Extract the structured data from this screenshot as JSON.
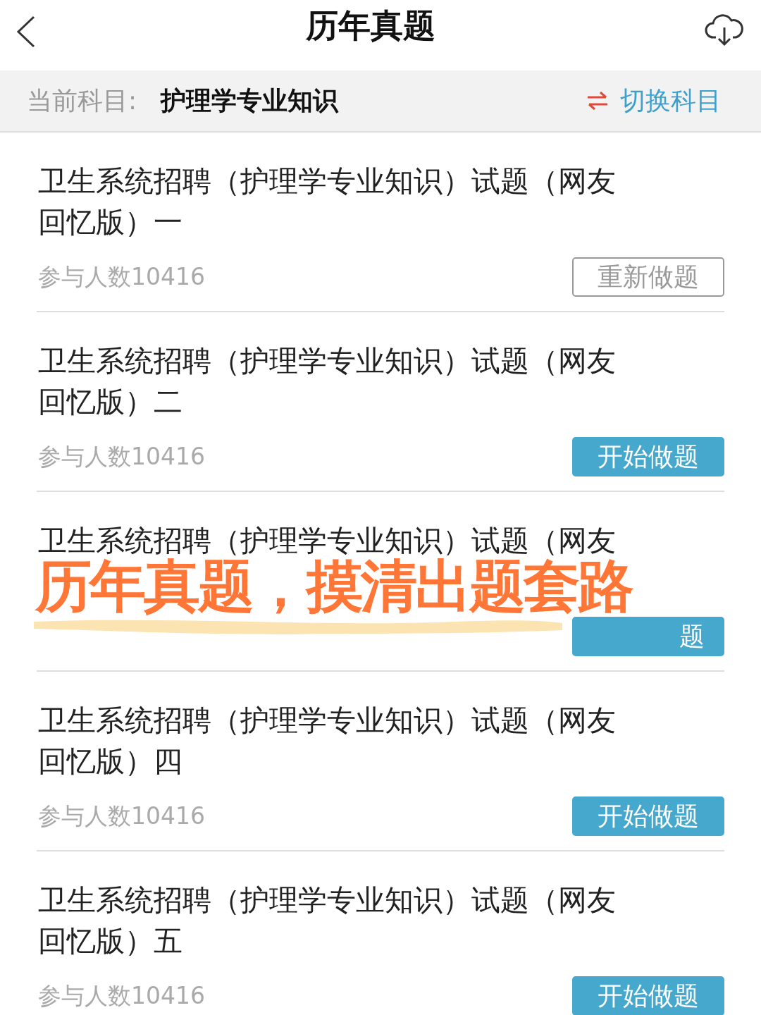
{
  "header": {
    "title": "历年真题"
  },
  "subject_bar": {
    "label": "当前科目:",
    "subject": "护理学专业知识",
    "switch_label": "切换科目"
  },
  "papers": [
    {
      "title": "卫生系统招聘（护理学专业知识）试题（网友回忆版）一",
      "participants": "参与人数10416",
      "button": {
        "kind": "redo",
        "label": "重新做题"
      }
    },
    {
      "title": "卫生系统招聘（护理学专业知识）试题（网友回忆版）二",
      "participants": "参与人数10416",
      "button": {
        "kind": "start",
        "label": "开始做题"
      }
    },
    {
      "title": "卫生系统招聘（护理学专业知识）试题（网友",
      "button": {
        "kind": "start",
        "label": "题"
      }
    },
    {
      "title": "卫生系统招聘（护理学专业知识）试题（网友回忆版）四",
      "participants": "参与人数10416",
      "button": {
        "kind": "start",
        "label": "开始做题"
      }
    },
    {
      "title": "卫生系统招聘（护理学专业知识）试题（网友回忆版）五",
      "participants": "参与人数10416",
      "button": {
        "kind": "start",
        "label": "开始做题"
      }
    }
  ],
  "overlay_caption": "历年真题，摸清出题套路"
}
